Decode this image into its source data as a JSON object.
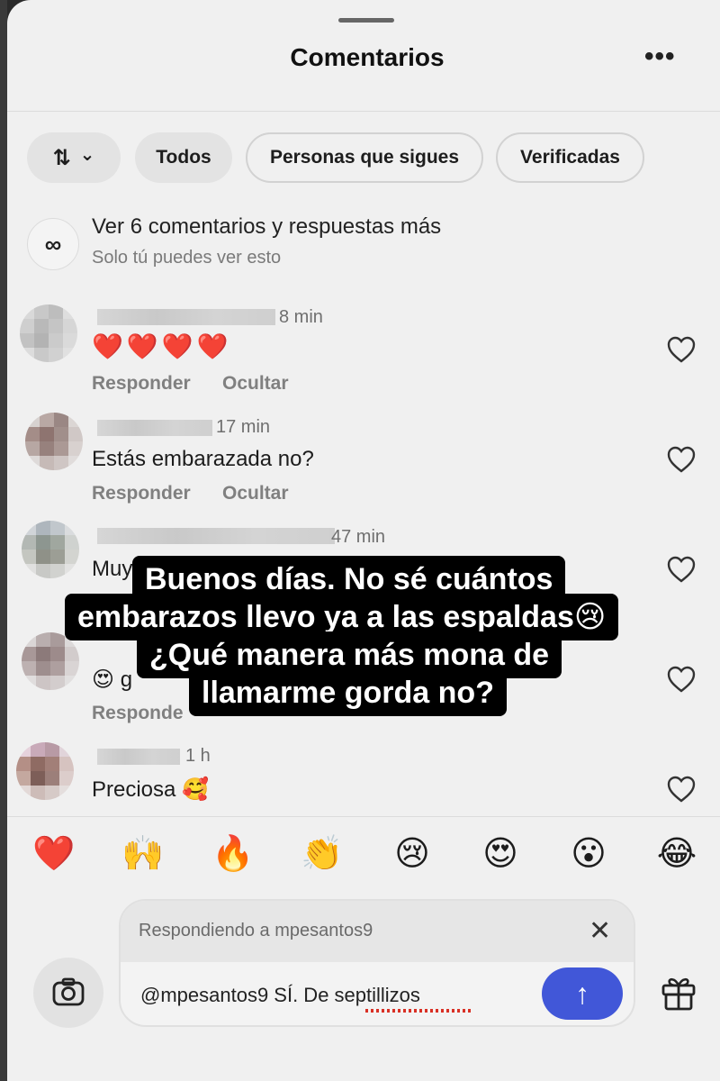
{
  "header": {
    "title": "Comentarios",
    "more_label": "•••"
  },
  "filters": {
    "sort_glyph": "⇅",
    "sort_chevron": "⌄",
    "chips": [
      "Todos",
      "Personas que sigues",
      "Verificadas"
    ]
  },
  "meta_notice": {
    "icon": "∞",
    "title": "Ver 6 comentarios y respuestas más",
    "subtitle": "Solo tú puedes ver esto"
  },
  "comments": [
    {
      "time": "8 min",
      "text": "❤️❤️❤️❤️",
      "reply_label": "Responder",
      "hide_label": "Ocultar"
    },
    {
      "time": "17 min",
      "text": "Estás embarazada no?",
      "reply_label": "Responder",
      "hide_label": "Ocultar"
    },
    {
      "time": "47 min",
      "text": "Muy"
    },
    {
      "text": "😍 g",
      "reply_label": "Respondе"
    },
    {
      "time": "1 h",
      "text": "Preciosa 🥰"
    }
  ],
  "reactions": [
    "❤️",
    "🙌",
    "🔥",
    "👏",
    "😢",
    "😍",
    "😮",
    "😂"
  ],
  "composer": {
    "replying_to": "Respondiendo a mpesantos9",
    "close_label": "✕",
    "text": "@mpesantos9 SÍ. De septillizos",
    "send_label": "↑"
  },
  "caption_lines": [
    "Buenos días. No sé cuántos",
    "embarazos llevo ya a las espaldas😢",
    "¿Qué manera más mona de",
    "llamarme gorda no?"
  ],
  "colors": {
    "sheet": "#f0f0f0",
    "send_button": "#4157d8",
    "heart": "#e0242b",
    "caption_bg": "#000000"
  },
  "icons": [
    "sort-icon",
    "chevron-down-icon",
    "meta-logo-icon",
    "heart-outline-icon",
    "camera-icon",
    "gift-icon",
    "close-icon",
    "send-arrow-icon"
  ]
}
